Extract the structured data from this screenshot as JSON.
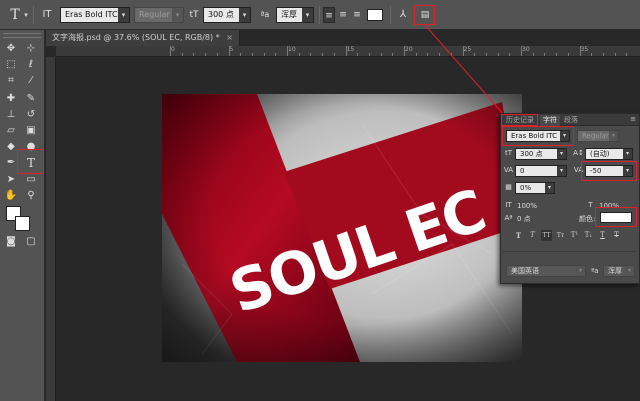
{
  "options_bar": {
    "tool_icon": "type-tool-icon",
    "font_family": "Eras Bold ITC",
    "font_style": "Regular",
    "font_size": "300 点",
    "aa_label": "ªa",
    "aa_method": "浑厚",
    "text_color": "#ffffff"
  },
  "document": {
    "tab_title": "文字海报.psd @ 37.6% (SOUL EC, RGB/8) *",
    "ruler_labels": [
      "0",
      "5",
      "10",
      "15",
      "20",
      "25",
      "30",
      "35",
      "40",
      "45"
    ],
    "canvas_text": "SOUL EC",
    "accent_color": "#b80c22"
  },
  "character_panel": {
    "tabs": [
      "历史记录",
      "字符",
      "段落"
    ],
    "font_family": "Eras Bold ITC",
    "font_style": "Regular",
    "font_size": "300 点",
    "leading": "(自动)",
    "kerning": "0",
    "tracking": "-50",
    "tsume": "0%",
    "vertical_scale": "100%",
    "horizontal_scale": "100%",
    "baseline_shift": "0 点",
    "color_label": "颜色:",
    "color": "#ffffff",
    "language": "美国英语",
    "aa_label": "ªa",
    "aa_method": "浑厚"
  },
  "highlight_color": "#e0202a"
}
